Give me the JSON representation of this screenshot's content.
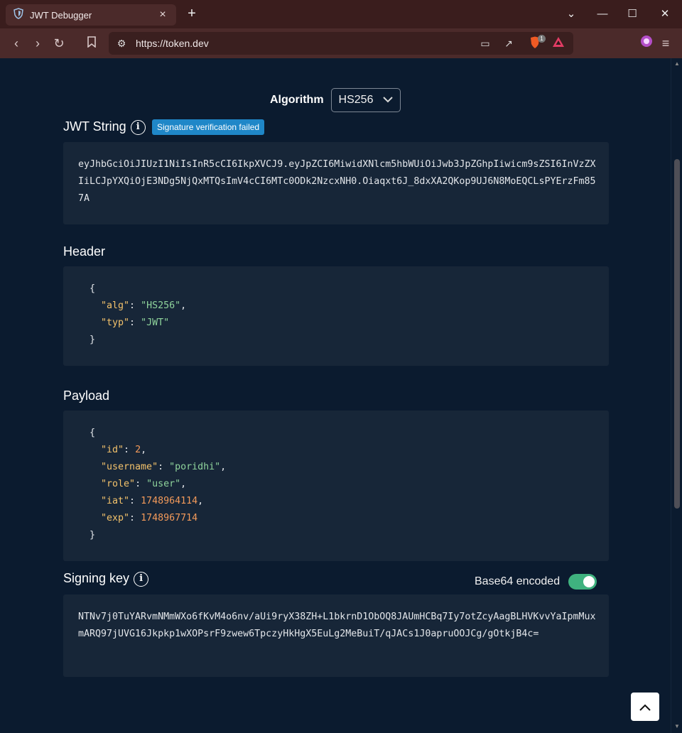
{
  "browser": {
    "tab_title": "JWT Debugger",
    "url": "https://token.dev",
    "brave_badge_count": "1"
  },
  "page": {
    "algorithm_label": "Algorithm",
    "algorithm_value": "HS256",
    "jwt_string_title": "JWT String",
    "signature_badge": "Signature verification failed",
    "jwt_string": "eyJhbGciOiJIUzI1NiIsInR5cCI6IkpXVCJ9.eyJpZCI6MiwidXNlcm5hbWUiOiJwb3JpZGhpIiwicm9sZSI6InVzZXIiLCJpYXQiOjE3NDg5NjQxMTQsImV4cCI6MTc0ODk2NzcxNH0.Oiaqxt6J_8dxXA2QKop9UJ6N8MoEQCLsPYErzFm857A",
    "header_title": "Header",
    "header_json": {
      "alg_key": "\"alg\"",
      "alg_val": "\"HS256\"",
      "typ_key": "\"typ\"",
      "typ_val": "\"JWT\""
    },
    "payload_title": "Payload",
    "payload_json": {
      "id_key": "\"id\"",
      "id_val": "2",
      "username_key": "\"username\"",
      "username_val": "\"poridhi\"",
      "role_key": "\"role\"",
      "role_val": "\"user\"",
      "iat_key": "\"iat\"",
      "iat_val": "1748964114",
      "exp_key": "\"exp\"",
      "exp_val": "1748967714"
    },
    "signing_key_title": "Signing key",
    "base64_label": "Base64 encoded",
    "base64_enabled": true,
    "signing_key": "NTNv7j0TuYARvmNMmWXo6fKvM4o6nv/aUi9ryX38ZH+L1bkrnD1ObOQ8JAUmHCBq7Iy7otZcyAagBLHVKvvYaIpmMuxmARQ97jUVG16Jkpkp1wXOPsrF9zwew6TpczyHkHgX5EuLg2MeBuiT/qJACs1J0apruOOJCg/gOtkjB4c="
  },
  "colors": {
    "page_bg": "#0b1b2f",
    "card_bg": "#172638",
    "json_key": "#f3c26b",
    "json_string": "#8fd49c",
    "json_number": "#f39a5a",
    "badge": "#1f87c8",
    "toggle_on": "#3fb27f"
  }
}
